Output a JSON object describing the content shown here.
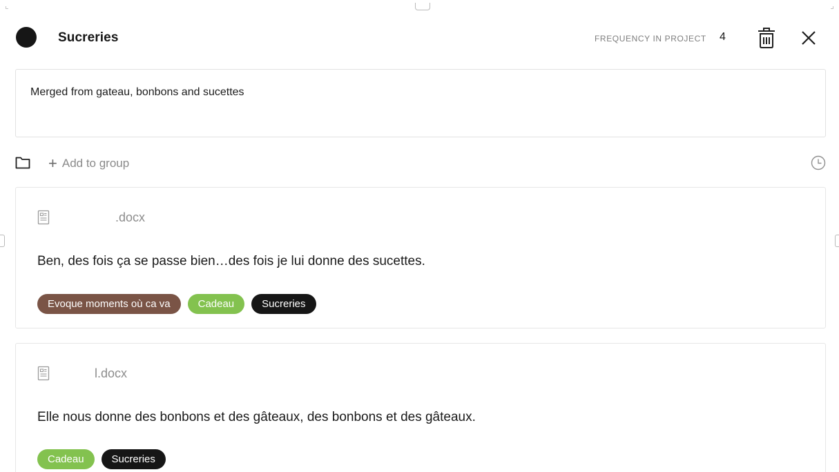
{
  "code": {
    "title": "Sucreries",
    "color": "#161616",
    "frequency_label": "FREQUENCY IN PROJECT",
    "frequency_value": "4"
  },
  "icons": {
    "delete": "trash-icon",
    "close": "close-icon",
    "folder": "folder-icon",
    "history": "clock-icon",
    "document": "document-icon"
  },
  "memo": {
    "text": "Merged from gateau, bonbons and sucettes"
  },
  "group": {
    "add_label": "Add to group",
    "plus": "+"
  },
  "quotes": [
    {
      "document": ".docx",
      "text": "Ben, des fois ça se passe bien…des fois je lui donne des sucettes.",
      "tags": [
        {
          "label": "Evoque moments où ca va",
          "color": "#7a5446"
        },
        {
          "label": "Cadeau",
          "color": "#83c24f"
        },
        {
          "label": "Sucreries",
          "color": "#161616"
        }
      ]
    },
    {
      "document": "l.docx",
      "text": "Elle nous donne des bonbons et des gâteaux, des bonbons et des gâteaux.",
      "tags": [
        {
          "label": "Cadeau",
          "color": "#83c24f"
        },
        {
          "label": "Sucreries",
          "color": "#161616"
        }
      ]
    }
  ]
}
